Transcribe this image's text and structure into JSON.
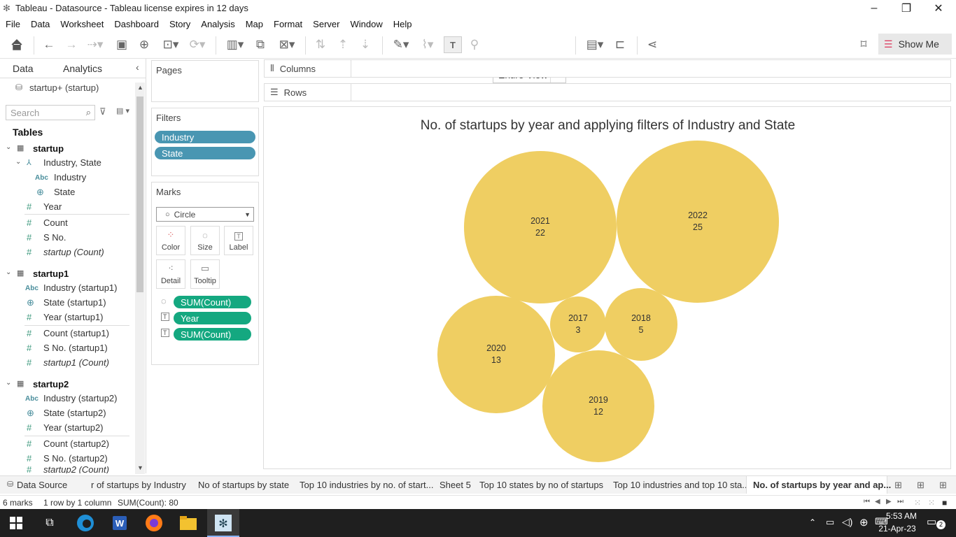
{
  "window": {
    "title": "Tableau - Datasource - Tableau license expires in 12 days"
  },
  "menu": [
    "File",
    "Data",
    "Worksheet",
    "Dashboard",
    "Story",
    "Analysis",
    "Map",
    "Format",
    "Server",
    "Window",
    "Help"
  ],
  "toolbar": {
    "entire_view": "Entire View",
    "show_me": "Show Me"
  },
  "left": {
    "tab_data": "Data",
    "tab_analytics": "Analytics",
    "datasource": "startup+ (startup)",
    "search_placeholder": "Search",
    "tables_label": "Tables",
    "startup": {
      "name": "startup",
      "hier": "Industry, State",
      "fields": [
        "Industry",
        "State",
        "Year",
        "Count",
        "S No.",
        "startup (Count)"
      ]
    },
    "startup1": {
      "name": "startup1",
      "fields": [
        "Industry (startup1)",
        "State (startup1)",
        "Year (startup1)",
        "Count (startup1)",
        "S No. (startup1)",
        "startup1 (Count)"
      ]
    },
    "startup2": {
      "name": "startup2",
      "fields": [
        "Industry (startup2)",
        "State (startup2)",
        "Year (startup2)",
        "Count (startup2)",
        "S No. (startup2)",
        "startup2 (Count)"
      ]
    }
  },
  "cards": {
    "pages": "Pages",
    "filters": "Filters",
    "filter_pills": [
      "Industry",
      "State"
    ],
    "marks": "Marks",
    "mark_type": "Circle",
    "mark_buttons": [
      "Color",
      "Size",
      "Label",
      "Detail",
      "Tooltip"
    ],
    "mark_pills": [
      "SUM(Count)",
      "Year",
      "SUM(Count)"
    ]
  },
  "shelves": {
    "columns": "Columns",
    "rows": "Rows"
  },
  "view": {
    "title": "No. of startups by year and applying filters of Industry and State"
  },
  "chart_data": {
    "type": "bubble",
    "title": "No. of startups by year and applying filters of Industry and State",
    "categories": [
      "2017",
      "2018",
      "2019",
      "2020",
      "2021",
      "2022"
    ],
    "values": [
      3,
      5,
      12,
      13,
      22,
      25
    ]
  },
  "sheet_tabs": [
    "Data Source",
    "r of startups by Industry",
    "No of startups by state",
    "Top 10 industries by no. of start...",
    "Sheet 5",
    "Top 10 states by no of startups",
    "Top 10 industries and top 10 sta...",
    "No. of startups by year and ap..."
  ],
  "status": {
    "marks": "6 marks",
    "rows": "1 row by 1 column",
    "sum": "SUM(Count): 80"
  },
  "clock": {
    "time": "5:53 AM",
    "date": "21-Apr-23",
    "notif": "2"
  }
}
